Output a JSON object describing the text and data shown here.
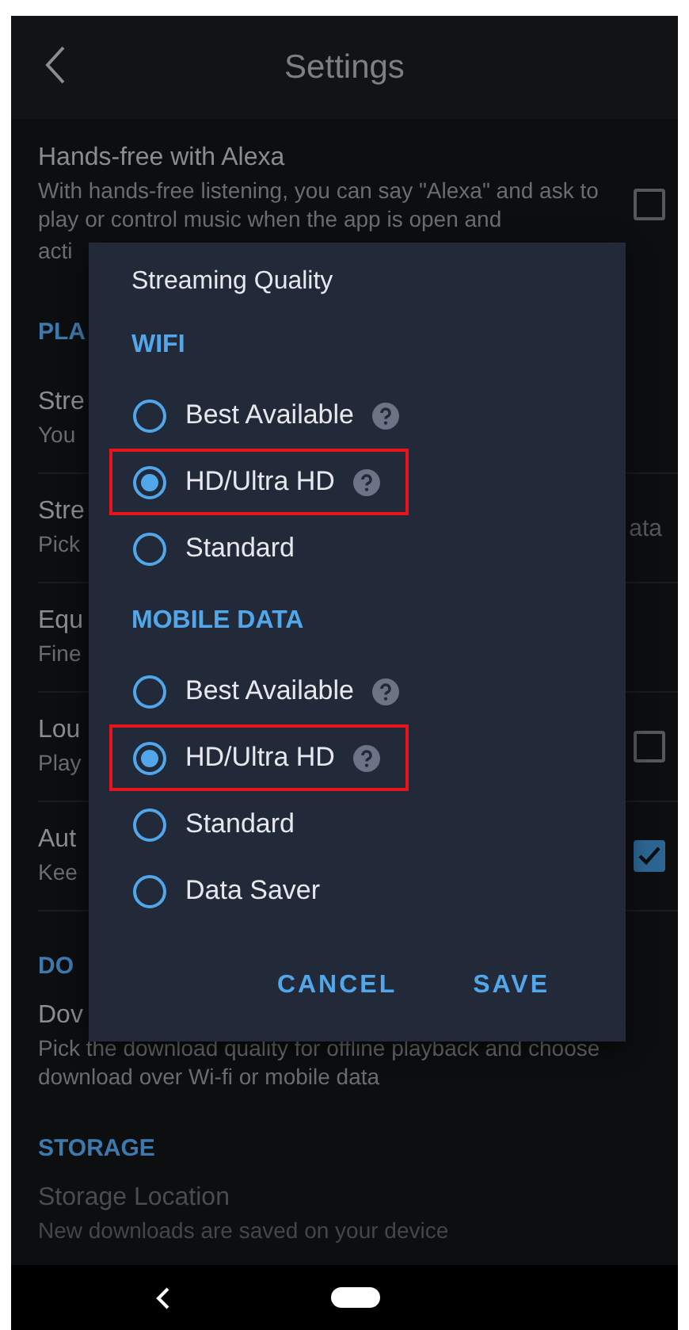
{
  "header": {
    "title": "Settings"
  },
  "settings": [
    {
      "kind": "item",
      "title": "Hands-free with Alexa",
      "description": "With hands-free listening, you can say \"Alexa\" and ask to play or control music when the app is open and",
      "description_tail": "acti",
      "checked": false
    },
    {
      "kind": "section",
      "title": "PLA"
    },
    {
      "kind": "item",
      "title": "Stre",
      "description": "You"
    },
    {
      "kind": "item",
      "title": "Stre",
      "description": "Pick",
      "trailing_text": "ata"
    },
    {
      "kind": "item",
      "title": "Equ",
      "description": "Fine"
    },
    {
      "kind": "item",
      "title": "Lou",
      "description": "Play",
      "checked": false
    },
    {
      "kind": "item",
      "title": "Aut",
      "description": "Kee",
      "checked": true
    },
    {
      "kind": "section",
      "title": "DO"
    },
    {
      "kind": "item",
      "title": "Dov",
      "description": "Pick the download quality for offline playback and choose download over Wi-fi or mobile data"
    },
    {
      "kind": "section",
      "title": "STORAGE"
    },
    {
      "kind": "faded",
      "title": "Storage Location",
      "description": "New downloads are saved on your device"
    }
  ],
  "dialog": {
    "title": "Streaming Quality",
    "groups": [
      {
        "title": "WIFI",
        "options": [
          {
            "label": "Best Available",
            "help": true,
            "selected": false,
            "highlighted": false
          },
          {
            "label": "HD/Ultra HD",
            "help": true,
            "selected": true,
            "highlighted": true
          },
          {
            "label": "Standard",
            "help": false,
            "selected": false,
            "highlighted": false
          }
        ]
      },
      {
        "title": "MOBILE DATA",
        "options": [
          {
            "label": "Best Available",
            "help": true,
            "selected": false,
            "highlighted": false
          },
          {
            "label": "HD/Ultra HD",
            "help": true,
            "selected": true,
            "highlighted": true
          },
          {
            "label": "Standard",
            "help": false,
            "selected": false,
            "highlighted": false
          },
          {
            "label": "Data Saver",
            "help": false,
            "selected": false,
            "highlighted": false
          }
        ]
      }
    ],
    "buttons": [
      "CANCEL",
      "SAVE"
    ]
  }
}
